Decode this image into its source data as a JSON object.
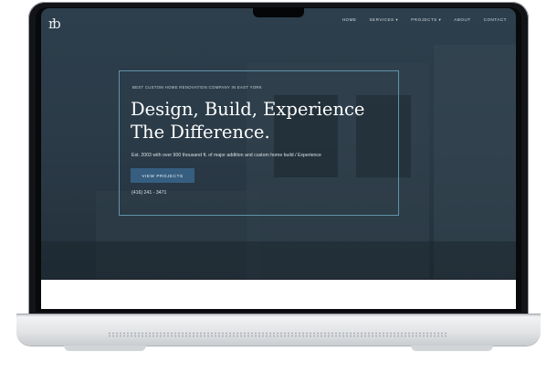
{
  "site": {
    "logo_text": "rb",
    "nav": [
      {
        "label": "HOME"
      },
      {
        "label": "SERVICES ▾"
      },
      {
        "label": "PROJECTS ▾"
      },
      {
        "label": "ABOUT"
      },
      {
        "label": "CONTACT"
      }
    ],
    "hero": {
      "kicker": "BEST CUSTOM HOME RENOVATION COMPANY IN EAST YORK",
      "headline_line1": "Design, Build, Experience",
      "headline_line2": "The Difference.",
      "description": "Est. 2003 with over 900 thousand ft. of major addition and custom home build / Experience",
      "cta_label": "VIEW PROJECTS",
      "phone": "(416) 241 - 3471"
    }
  },
  "colors": {
    "hero_overlay": "#2b3b48",
    "accent_border": "#5f93a8",
    "button": "#365e80"
  }
}
